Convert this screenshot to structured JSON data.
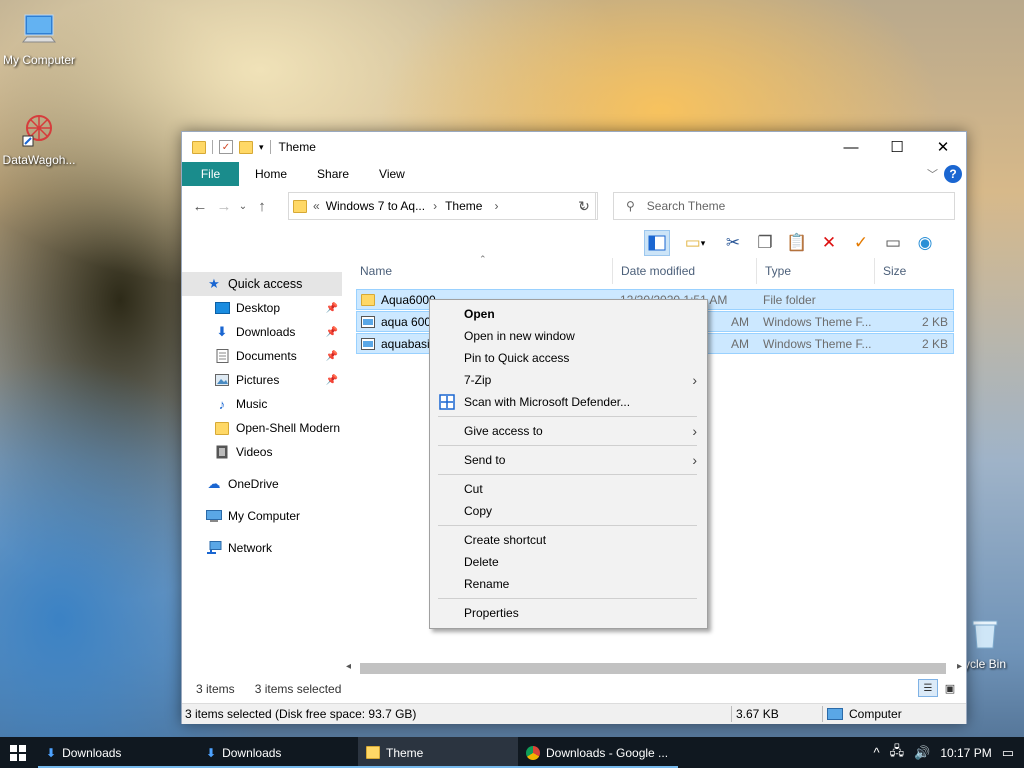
{
  "desktop": {
    "icons": [
      {
        "label": "My Computer"
      },
      {
        "label": "DataWagoh..."
      },
      {
        "label": "cycle Bin"
      }
    ]
  },
  "window": {
    "title": "Theme",
    "controls": {
      "minimize": "—",
      "maximize": "☐",
      "close": "✕"
    },
    "ribbon": {
      "tabs": [
        "File",
        "Home",
        "Share",
        "View"
      ],
      "help": "?"
    },
    "address": {
      "overflow": "«",
      "crumbs": [
        "Windows 7 to Aq...",
        "Theme"
      ],
      "separator": "›"
    },
    "search": {
      "placeholder": "Search Theme"
    },
    "nav": {
      "items": [
        {
          "label": "Quick access",
          "icon": "star-icon"
        },
        {
          "label": "Desktop",
          "icon": "desktop-icon"
        },
        {
          "label": "Downloads",
          "icon": "download-icon"
        },
        {
          "label": "Documents",
          "icon": "documents-icon"
        },
        {
          "label": "Pictures",
          "icon": "pictures-icon"
        },
        {
          "label": "Music",
          "icon": "music-icon"
        },
        {
          "label": "Open-Shell Modern",
          "icon": "folder-icon"
        },
        {
          "label": "Videos",
          "icon": "videos-icon"
        },
        {
          "label": "OneDrive",
          "icon": "cloud-icon"
        },
        {
          "label": "My Computer",
          "icon": "computer-icon"
        },
        {
          "label": "Network",
          "icon": "network-icon"
        }
      ]
    },
    "columns": [
      "Name",
      "Date modified",
      "Type",
      "Size"
    ],
    "files": [
      {
        "name": "Aqua6000",
        "date": "12/30/2020 1:51 AM",
        "type": "File folder",
        "size": ""
      },
      {
        "name": "aqua 6000",
        "date": "AM",
        "type": "Windows Theme F...",
        "size": "2 KB"
      },
      {
        "name": "aquabasic",
        "date": "AM",
        "type": "Windows Theme F...",
        "size": "2 KB"
      }
    ],
    "status_inner": {
      "count": "3 items",
      "selected": "3 items selected"
    },
    "statusbar": {
      "info": "3 items selected (Disk free space: 93.7 GB)",
      "size": "3.67 KB",
      "location": "Computer"
    }
  },
  "context_menu": {
    "items": [
      {
        "label": "Open"
      },
      {
        "label": "Open in new window"
      },
      {
        "label": "Pin to Quick access"
      },
      {
        "label": "7-Zip"
      },
      {
        "label": "Scan with Microsoft Defender..."
      },
      {
        "label": "Give access to"
      },
      {
        "label": "Send to"
      },
      {
        "label": "Cut"
      },
      {
        "label": "Copy"
      },
      {
        "label": "Create shortcut"
      },
      {
        "label": "Delete"
      },
      {
        "label": "Rename"
      },
      {
        "label": "Properties"
      }
    ]
  },
  "taskbar": {
    "start_icon": "windows-logo-icon",
    "buttons": [
      {
        "label": "Downloads"
      },
      {
        "label": "Downloads"
      },
      {
        "label": "Theme"
      },
      {
        "label": "Downloads - Google ..."
      }
    ],
    "clock": "10:17 PM"
  }
}
